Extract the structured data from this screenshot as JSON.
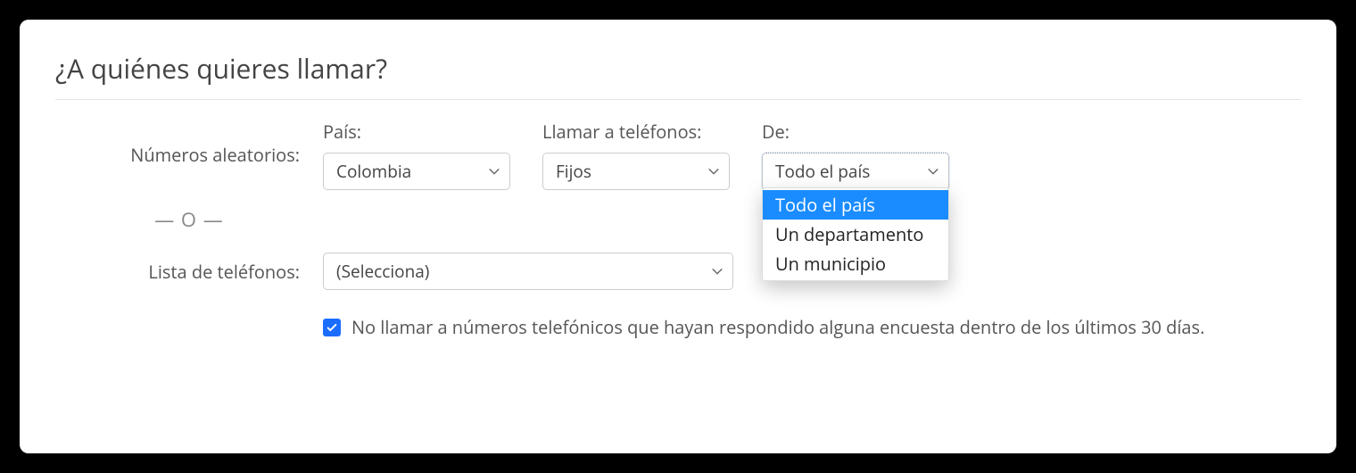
{
  "title": "¿A quiénes quieres llamar?",
  "labels": {
    "random_numbers": "Números aleatorios:",
    "country": "País:",
    "call_phones": "Llamar a teléfonos:",
    "from": "De:",
    "or": "— O —",
    "phone_list": "Lista de teléfonos:"
  },
  "selects": {
    "country": {
      "value": "Colombia"
    },
    "phone_type": {
      "value": "Fijos"
    },
    "from": {
      "value": "Todo el país",
      "options": [
        "Todo el país",
        "Un departamento",
        "Un municipio"
      ],
      "open": true,
      "highlight_index": 0
    },
    "phone_list": {
      "value": "(Selecciona)"
    }
  },
  "checkbox": {
    "checked": true,
    "label": "No llamar a números telefónicos que hayan respondido alguna encuesta dentro de los últimos 30 días."
  }
}
